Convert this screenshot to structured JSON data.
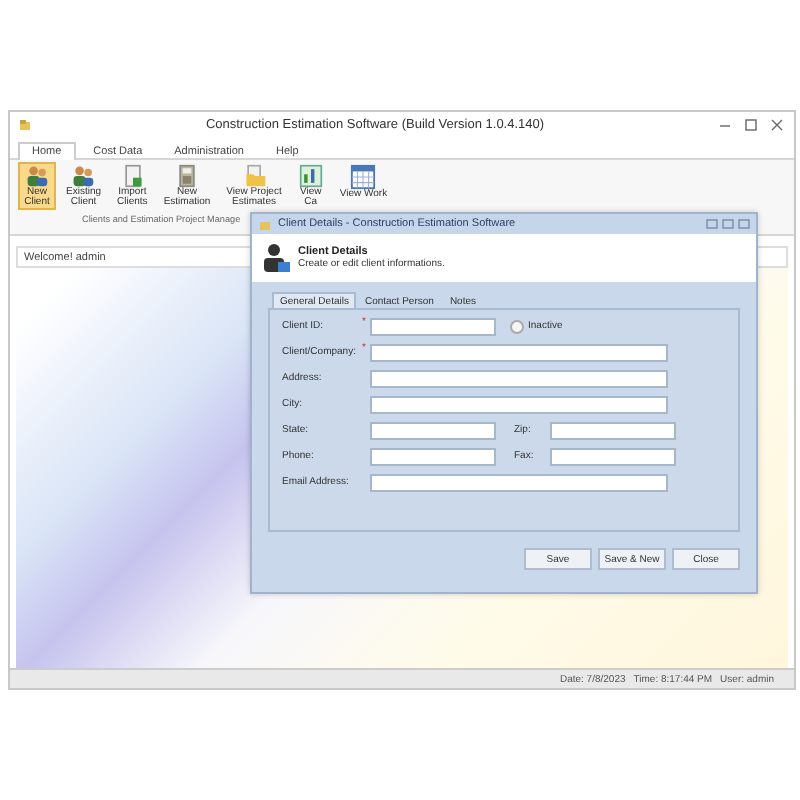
{
  "window": {
    "title": "Construction Estimation Software (Build Version 1.0.4.140)"
  },
  "tabs": [
    {
      "label": "Home",
      "selected": true
    },
    {
      "label": "Cost Data",
      "selected": false
    },
    {
      "label": "Administration",
      "selected": false
    },
    {
      "label": "Help",
      "selected": false
    }
  ],
  "ribbon": {
    "buttons": [
      {
        "lines": [
          "New",
          "Client"
        ],
        "selected": true
      },
      {
        "lines": [
          "Existing",
          "Client"
        ],
        "selected": false
      },
      {
        "lines": [
          "Import",
          "Clients"
        ],
        "selected": false
      },
      {
        "lines": [
          "New",
          "Estimation"
        ],
        "selected": false
      },
      {
        "lines": [
          "View Project",
          "Estimates"
        ],
        "selected": false
      },
      {
        "lines": [
          "View",
          "Ca"
        ],
        "selected": false
      },
      {
        "lines": [
          "View Work"
        ],
        "selected": false
      }
    ],
    "group_label": "Clients and Estimation Project Manage"
  },
  "welcome": "Welcome! admin",
  "status_bar": [
    "Date: 7/8/2023",
    "Time: 8:17:44 PM",
    "User: admin"
  ],
  "dialog": {
    "title": "Client Details - Construction Estimation Software",
    "header_title": "Client Details",
    "header_subtitle": "Create or edit client informations.",
    "tabs": [
      {
        "label": "General Details",
        "selected": true
      },
      {
        "label": "Contact Person",
        "selected": false
      },
      {
        "label": "Notes",
        "selected": false
      }
    ],
    "rows": [
      {
        "fields": [
          {
            "label": "Client ID:",
            "mark": "*"
          }
        ],
        "checkbox": {
          "label": "Inactive",
          "checked": false
        }
      },
      {
        "fields": [
          {
            "label": "Client/Company:",
            "mark": "*"
          }
        ]
      },
      {
        "fields": [
          {
            "label": "Address:"
          }
        ]
      },
      {
        "fields": [
          {
            "label": "City:"
          }
        ]
      },
      {
        "fields": [
          {
            "label": "State:"
          },
          {
            "label": "Zip:"
          }
        ]
      },
      {
        "fields": [
          {
            "label": "Phone:"
          },
          {
            "label": "Fax:"
          }
        ]
      },
      {
        "fields": [
          {
            "label": "Email Address:"
          }
        ]
      }
    ],
    "buttons": [
      "Save",
      "Save & New",
      "Close"
    ]
  }
}
